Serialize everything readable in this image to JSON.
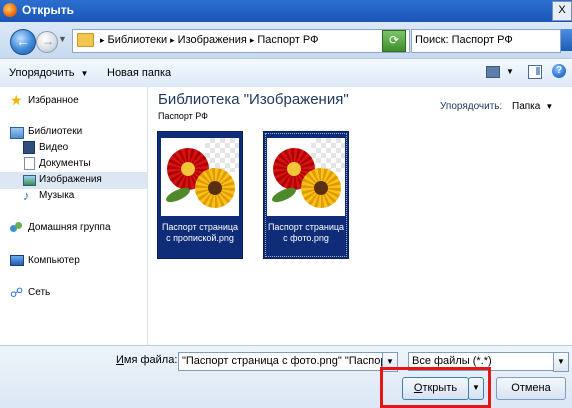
{
  "window": {
    "title": "Открыть",
    "close_glyph": "X"
  },
  "address": {
    "segments": [
      "Библиотеки",
      "Изображения",
      "Паспорт РФ"
    ],
    "search_value": "Поиск: Паспорт РФ"
  },
  "toolbar": {
    "organize": "Упорядочить",
    "new_folder": "Новая папка",
    "help": "?"
  },
  "nav": {
    "favorites": "Избранное",
    "libraries": "Библиотеки",
    "video": "Видео",
    "documents": "Документы",
    "images": "Изображения",
    "music": "Музыка",
    "homegroup": "Домашняя группа",
    "computer": "Компьютер",
    "network": "Сеть"
  },
  "content": {
    "title": "Библиотека \"Изображения\"",
    "subtitle": "Паспорт РФ",
    "arrange_label": "Упорядочить:",
    "arrange_value": "Папка",
    "files": [
      {
        "line1": "Паспорт страница",
        "line2": "с пропиской.png"
      },
      {
        "line1": "Паспорт страница",
        "line2": "с фото.png"
      }
    ]
  },
  "bottom": {
    "filename_label_accel": "И",
    "filename_label_rest": "мя файла:",
    "filename_value": "\"Паспорт страница с фото.png\" \"Паспорт с",
    "filetype": "Все файлы (*.*)",
    "open_accel": "О",
    "open_rest": "ткрыть",
    "cancel": "Отмена"
  },
  "colors": {
    "selection": "#0e2c77",
    "highlight": "#e51616",
    "title_bar": "#1a55b5"
  },
  "icons": [
    "back-arrow-icon",
    "forward-arrow-icon",
    "folder-icon",
    "refresh-icon",
    "search-icon",
    "star-icon",
    "library-icon",
    "video-icon",
    "document-icon",
    "image-icon",
    "music-icon",
    "homegroup-icon",
    "computer-icon",
    "network-icon",
    "view-icon",
    "preview-pane-icon",
    "help-icon"
  ]
}
